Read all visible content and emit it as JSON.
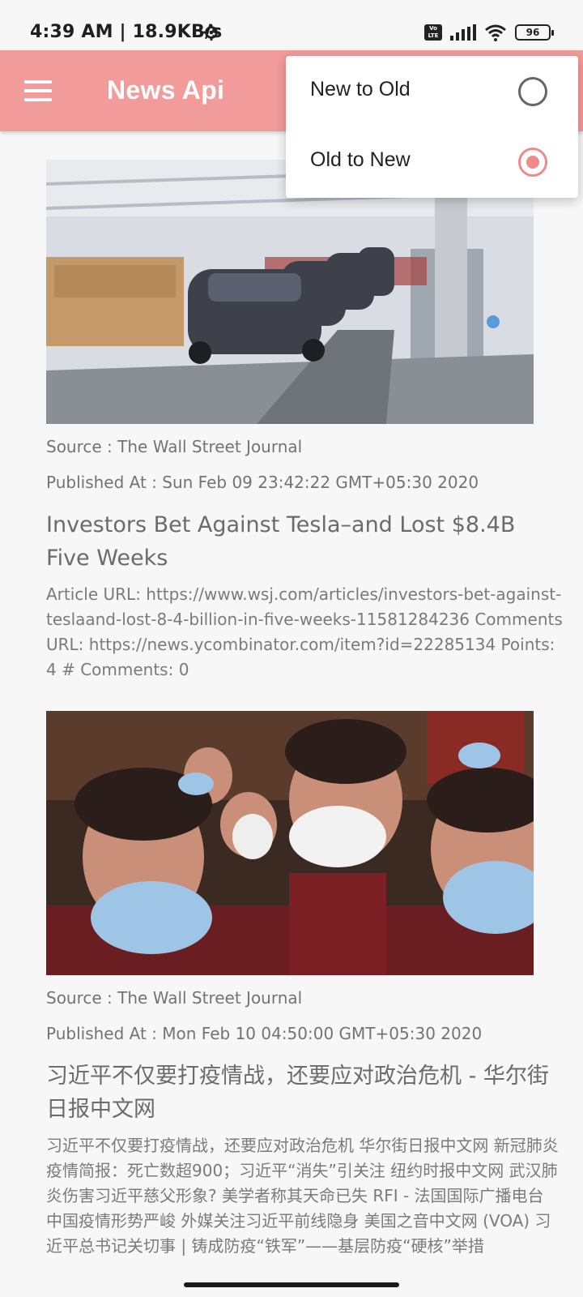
{
  "status_bar": {
    "time_speed": "4:39 AM | 18.9KB/s",
    "volte_label": "Vo LTE",
    "battery": "96"
  },
  "app_bar": {
    "title": "News Api"
  },
  "sort_menu": {
    "options": [
      {
        "label": "New to Old",
        "selected": false
      },
      {
        "label": "Old to New",
        "selected": true
      }
    ]
  },
  "articles": [
    {
      "image_icon": "tesla-factory-photo",
      "source": "Source : The Wall Street Journal",
      "published": "Published At : Sun Feb 09 23:42:22 GMT+05:30 2020",
      "title": "Investors Bet Against Tesla–and Lost $8.4B Five Weeks",
      "description": "Article URL: https://www.wsj.com/articles/investors-bet-against-teslaand-lost-8-4-billion-in-five-weeks-11581284236 Comments URL: https://news.ycombinator.com/item?id=22285134 Points: 4 # Comments: 0"
    },
    {
      "image_icon": "masked-crowd-photo",
      "source": "Source : The Wall Street Journal",
      "published": "Published At : Mon Feb 10 04:50:00 GMT+05:30 2020",
      "title": "习近平不仅要打疫情战，还要应对政治危机 - 华尔街日报中文网",
      "description": "习近平不仅要打疫情战，还要应对政治危机 华尔街日报中文网 新冠肺炎疫情简报：死亡数超900；习近平“消失”引关注 纽约时报中文网 武汉肺炎伤害习近平慈父形象? 美学者称其天命已失 RFI - 法国国际广播电台 中国疫情形势严峻 外媒关注习近平前线隐身 美国之音中文网 (VOA) 习近平总书记关切事 | 铸成防疫“铁军”——基层防疫“硬核”举措"
    }
  ],
  "colors": {
    "accent": "#f19b9b",
    "radio_selected": "#f08a8a"
  }
}
